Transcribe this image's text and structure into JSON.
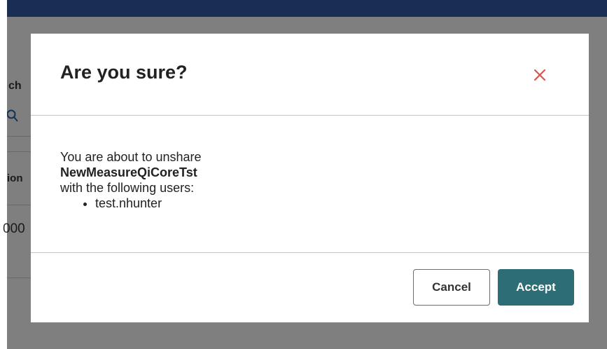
{
  "background": {
    "fragments": {
      "search_label": "ch",
      "column_header": "ion",
      "cell_value": "000"
    }
  },
  "modal": {
    "title": "Are you sure?",
    "body": {
      "intro": "You are about to unshare",
      "measure_name": "NewMeasureQiCoreTst",
      "users_intro": "with the following users:",
      "users": [
        "test.nhunter"
      ]
    },
    "buttons": {
      "cancel": "Cancel",
      "accept": "Accept"
    }
  },
  "colors": {
    "accent": "#2d6e76",
    "close_icon": "#d9534f",
    "topbar": "#1a2d52"
  },
  "icons": {
    "close": "close-icon",
    "search": "search-icon"
  }
}
